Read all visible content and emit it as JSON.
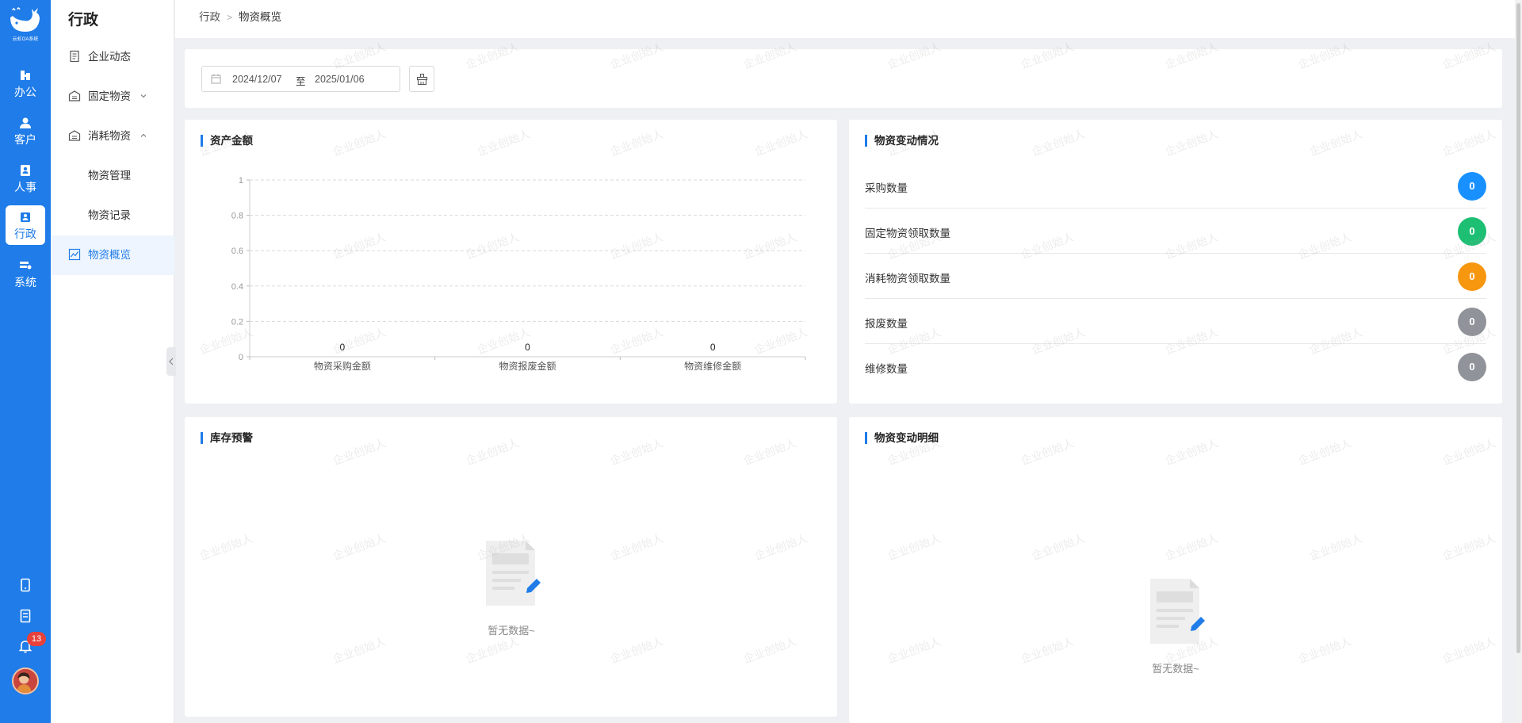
{
  "brand": {
    "logo_text": "云虹OA系统"
  },
  "rail": {
    "items": [
      {
        "label": "办公",
        "icon": "office-icon"
      },
      {
        "label": "客户",
        "icon": "customer-icon"
      },
      {
        "label": "人事",
        "icon": "hr-icon"
      },
      {
        "label": "行政",
        "icon": "admin-icon",
        "active": true
      },
      {
        "label": "系统",
        "icon": "system-icon"
      }
    ],
    "notification_count": "13"
  },
  "subnav": {
    "title": "行政",
    "items": [
      {
        "label": "企业动态",
        "icon": "document-icon"
      },
      {
        "label": "固定物资",
        "icon": "warehouse-icon",
        "expanded": false
      },
      {
        "label": "消耗物资",
        "icon": "warehouse-icon",
        "expanded": true
      },
      {
        "label": "物资管理"
      },
      {
        "label": "物资记录"
      },
      {
        "label": "物资概览",
        "icon": "chart-icon",
        "active": true
      }
    ]
  },
  "breadcrumb": {
    "root": "行政",
    "current": "物资概览"
  },
  "filter": {
    "start_date": "2024/12/07",
    "separator": "至",
    "end_date": "2025/01/06"
  },
  "asset_card": {
    "title": "资产金额"
  },
  "chart_data": {
    "type": "bar",
    "categories": [
      "物资采购金额",
      "物资报废金额",
      "物资维修金额"
    ],
    "values": [
      0,
      0,
      0
    ],
    "data_labels": [
      "0",
      "0",
      "0"
    ],
    "ylim": [
      0,
      1
    ],
    "yticks": [
      "0",
      "0.2",
      "0.4",
      "0.6",
      "0.8",
      "1"
    ],
    "grid": true
  },
  "changes_card": {
    "title": "物资变动情况",
    "rows": [
      {
        "label": "采购数量",
        "value": "0",
        "color": "#1890ff"
      },
      {
        "label": "固定物资领取数量",
        "value": "0",
        "color": "#1dbf73"
      },
      {
        "label": "消耗物资领取数量",
        "value": "0",
        "color": "#f7960f"
      },
      {
        "label": "报废数量",
        "value": "0",
        "color": "#909399"
      },
      {
        "label": "维修数量",
        "value": "0",
        "color": "#909399"
      }
    ]
  },
  "stock_card": {
    "title": "库存预警",
    "empty_text": "暂无数据~"
  },
  "detail_card": {
    "title": "物资变动明细",
    "empty_text": "暂无数据~"
  },
  "watermark": {
    "text": "企业创始人"
  }
}
